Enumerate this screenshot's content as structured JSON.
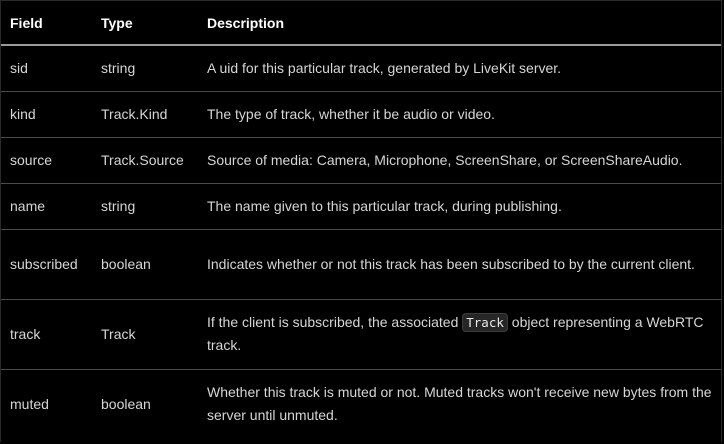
{
  "headers": {
    "field": "Field",
    "type": "Type",
    "description": "Description"
  },
  "rows": [
    {
      "field": "sid",
      "type": "string",
      "description": "A uid for this particular track, generated by LiveKit server."
    },
    {
      "field": "kind",
      "type": "Track.Kind",
      "description": "The type of track, whether it be audio or video."
    },
    {
      "field": "source",
      "type": "Track.Source",
      "description": "Source of media: Camera, Microphone, ScreenShare, or ScreenShareAudio."
    },
    {
      "field": "name",
      "type": "string",
      "description": "The name given to this particular track, during publishing."
    },
    {
      "field": "subscribed",
      "type": "boolean",
      "description": "Indicates whether or not this track has been subscribed to by the current client."
    },
    {
      "field": "track",
      "type": "Track",
      "description_before": "If the client is subscribed, the associated",
      "description_code": "Track",
      "description_after": "object representing a WebRTC track."
    },
    {
      "field": "muted",
      "type": "boolean",
      "description": "Whether this track is muted or not. Muted tracks won't receive new bytes from the server until unmuted."
    }
  ]
}
